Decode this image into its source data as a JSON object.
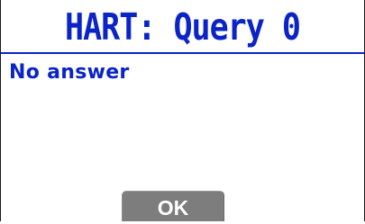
{
  "window": {
    "title": "HART: Query 0"
  },
  "dialog": {
    "message": "No answer"
  },
  "buttons": {
    "ok_label": "OK"
  },
  "colors": {
    "accent": "#0a24c8",
    "button_bg": "#7d7d7d",
    "button_text": "#ffffff",
    "background": "#ffffff"
  }
}
